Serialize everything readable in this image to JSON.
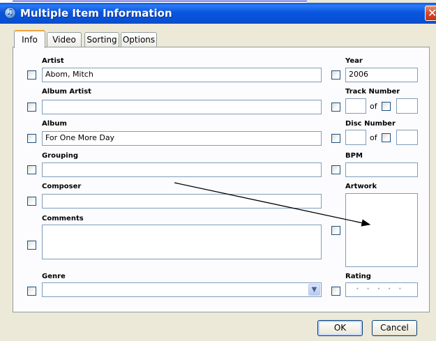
{
  "window": {
    "title": "Multiple Item Information",
    "close_glyph": "✕"
  },
  "tabs": [
    {
      "label": "Info",
      "active": true
    },
    {
      "label": "Video"
    },
    {
      "label": "Sorting"
    },
    {
      "label": "Options"
    }
  ],
  "fields": {
    "artist": {
      "label": "Artist",
      "value": "Abom, Mitch"
    },
    "album_artist": {
      "label": "Album Artist",
      "value": ""
    },
    "album": {
      "label": "Album",
      "value": "For One More Day"
    },
    "grouping": {
      "label": "Grouping",
      "value": ""
    },
    "composer": {
      "label": "Composer",
      "value": ""
    },
    "comments": {
      "label": "Comments",
      "value": ""
    },
    "genre": {
      "label": "Genre",
      "value": ""
    },
    "year": {
      "label": "Year",
      "value": "2006"
    },
    "track_number": {
      "label": "Track Number",
      "value": "",
      "of_label": "of",
      "total": ""
    },
    "disc_number": {
      "label": "Disc Number",
      "value": "",
      "of_label": "of",
      "total": ""
    },
    "bpm": {
      "label": "BPM",
      "value": ""
    },
    "artwork": {
      "label": "Artwork"
    },
    "rating": {
      "label": "Rating",
      "dots": "• • • • •"
    }
  },
  "buttons": {
    "ok": "OK",
    "cancel": "Cancel"
  },
  "icons": {
    "app": "itunes-icon",
    "dropdown": "chevron-down-icon",
    "close": "close-icon"
  },
  "colors": {
    "titlebar": "#0a56df",
    "dialog_bg": "#ece9d8",
    "panel_bg": "#fcfcfe",
    "arrow": "#000000"
  }
}
